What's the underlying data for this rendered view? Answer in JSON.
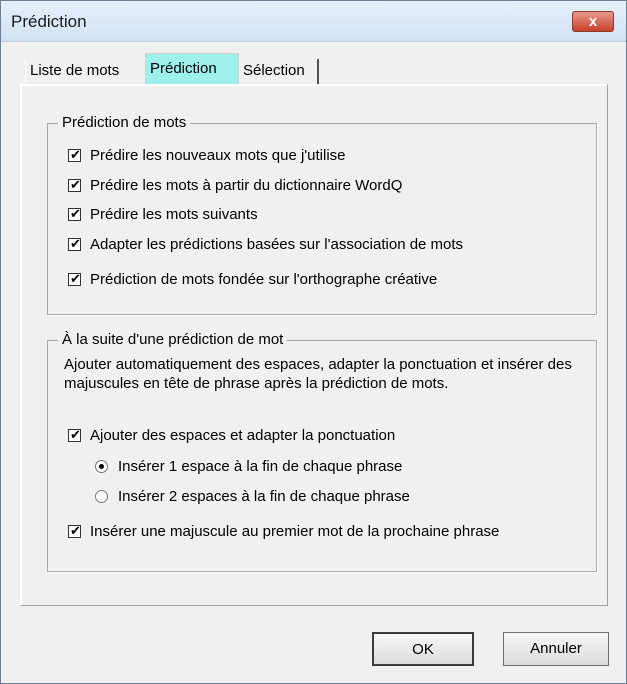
{
  "window": {
    "title": "Prédiction",
    "close_label": "x"
  },
  "tabs": [
    {
      "label": "Liste de mots",
      "selected": false
    },
    {
      "label": "Prédiction",
      "selected": true
    },
    {
      "label": "Sélection",
      "selected": false
    }
  ],
  "group_word_prediction": {
    "legend": "Prédiction de mots",
    "options": [
      {
        "label": "Prédire les nouveaux mots que j'utilise",
        "checked": true
      },
      {
        "label": "Prédire les mots à partir du dictionnaire WordQ",
        "checked": true
      },
      {
        "label": "Prédire les mots suivants",
        "checked": true
      },
      {
        "label": "Adapter les prédictions basées sur l'association de mots",
        "checked": true
      },
      {
        "label": "Prédiction de mots fondée sur l'orthographe créative",
        "checked": true
      }
    ]
  },
  "group_after_prediction": {
    "legend": "À la suite d'une prédiction de mot",
    "description": "Ajouter automatiquement des espaces, adapter la ponctuation et insérer des majuscules en tête de phrase après la prédiction de mots.",
    "add_spaces": {
      "label": "Ajouter des espaces et adapter la ponctuation",
      "checked": true
    },
    "radio_one_space": {
      "label": "Insérer 1 espace à la fin de chaque phrase",
      "selected": true
    },
    "radio_two_spaces": {
      "label": "Insérer 2 espaces à la fin de chaque phrase",
      "selected": false
    },
    "capitalize": {
      "label": "Insérer une majuscule au premier mot de la prochaine phrase",
      "checked": true
    }
  },
  "buttons": {
    "ok": "OK",
    "cancel": "Annuler"
  },
  "check_glyph": "✔"
}
